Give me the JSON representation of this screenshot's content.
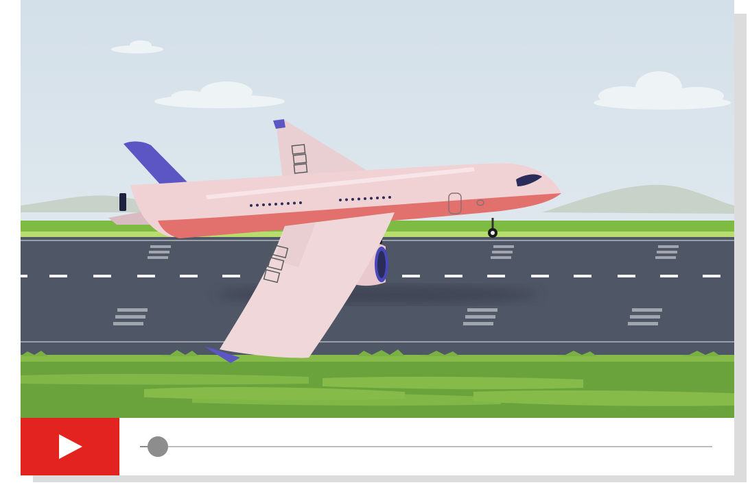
{
  "player": {
    "video": {
      "scene": "airplane-takeoff-runway",
      "sky_color": "#d6e1ea",
      "grass_color": "#6aa33c",
      "runway_color": "#4f5766",
      "fuselage_color": "#f1d2d4",
      "belly_color": "#e2706c",
      "tail_color": "#5b56c4"
    },
    "controls": {
      "play_icon": "play-icon",
      "accent_color": "#e32320",
      "progress": 0.03
    }
  }
}
